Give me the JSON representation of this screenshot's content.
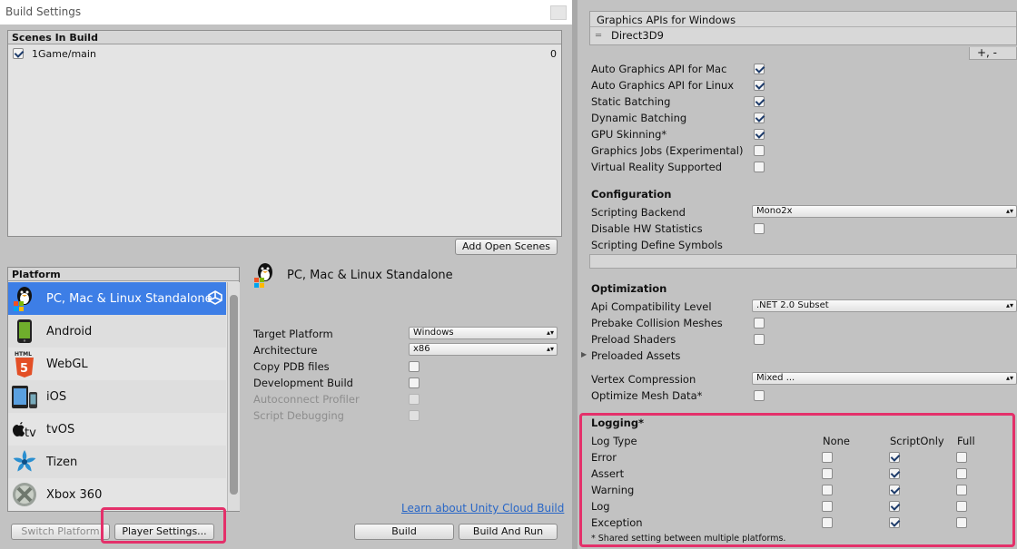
{
  "window": {
    "title": "Build Settings"
  },
  "scenes": {
    "header": "Scenes In Build",
    "items": [
      {
        "name": "1Game/main",
        "index": "0",
        "checked": true
      }
    ],
    "add_open_scenes": "Add Open Scenes"
  },
  "platform": {
    "header": "Platform",
    "items": [
      {
        "name": "PC, Mac & Linux Standalone",
        "icon": "standalone-icon",
        "selected": true
      },
      {
        "name": "Android",
        "icon": "android-icon"
      },
      {
        "name": "WebGL",
        "icon": "html5-icon"
      },
      {
        "name": "iOS",
        "icon": "ios-icon"
      },
      {
        "name": "tvOS",
        "icon": "appletv-icon"
      },
      {
        "name": "Tizen",
        "icon": "tizen-icon"
      },
      {
        "name": "Xbox 360",
        "icon": "xbox-icon"
      }
    ]
  },
  "standalone": {
    "title": "PC, Mac & Linux Standalone",
    "target_platform_label": "Target Platform",
    "target_platform_value": "Windows",
    "architecture_label": "Architecture",
    "architecture_value": "x86",
    "copy_pdb_label": "Copy PDB files",
    "development_build_label": "Development Build",
    "autoconnect_label": "Autoconnect Profiler",
    "script_debugging_label": "Script Debugging"
  },
  "footer": {
    "cloud_link": "Learn about Unity Cloud Build",
    "switch_platform": "Switch Platform",
    "player_settings": "Player Settings...",
    "build": "Build",
    "build_and_run": "Build And Run"
  },
  "player": {
    "graphics_apis_header": "Graphics APIs for Windows",
    "graphics_api_item": "Direct3D9",
    "plus_minus": "+,  -",
    "rendering": [
      {
        "label": "Auto Graphics API for Mac",
        "checked": true
      },
      {
        "label": "Auto Graphics API for Linux",
        "checked": true
      },
      {
        "label": "Static Batching",
        "checked": true
      },
      {
        "label": "Dynamic Batching",
        "checked": true
      },
      {
        "label": "GPU Skinning*",
        "checked": true
      },
      {
        "label": "Graphics Jobs (Experimental)",
        "checked": false
      },
      {
        "label": "Virtual Reality Supported",
        "checked": false
      }
    ],
    "configuration": {
      "header": "Configuration",
      "scripting_backend_label": "Scripting Backend",
      "scripting_backend_value": "Mono2x",
      "disable_hw_label": "Disable HW Statistics",
      "define_symbols_label": "Scripting Define Symbols"
    },
    "optimization": {
      "header": "Optimization",
      "api_compat_label": "Api Compatibility Level",
      "api_compat_value": ".NET 2.0 Subset",
      "prebake_label": "Prebake Collision Meshes",
      "preload_shaders_label": "Preload Shaders",
      "preloaded_assets_label": "Preloaded Assets",
      "vertex_compression_label": "Vertex Compression",
      "vertex_compression_value": "Mixed ...",
      "optimize_mesh_label": "Optimize Mesh Data*"
    },
    "logging": {
      "header": "Logging*",
      "col_type": "Log Type",
      "col_none": "None",
      "col_scriptonly": "ScriptOnly",
      "col_full": "Full",
      "rows": [
        {
          "label": "Error",
          "value": "ScriptOnly"
        },
        {
          "label": "Assert",
          "value": "ScriptOnly"
        },
        {
          "label": "Warning",
          "value": "ScriptOnly"
        },
        {
          "label": "Log",
          "value": "ScriptOnly"
        },
        {
          "label": "Exception",
          "value": "ScriptOnly"
        }
      ],
      "note": "* Shared setting between multiple platforms."
    }
  },
  "colors": {
    "highlight": "#e4306a",
    "selection": "#3d7ee6",
    "link": "#2866c6"
  }
}
